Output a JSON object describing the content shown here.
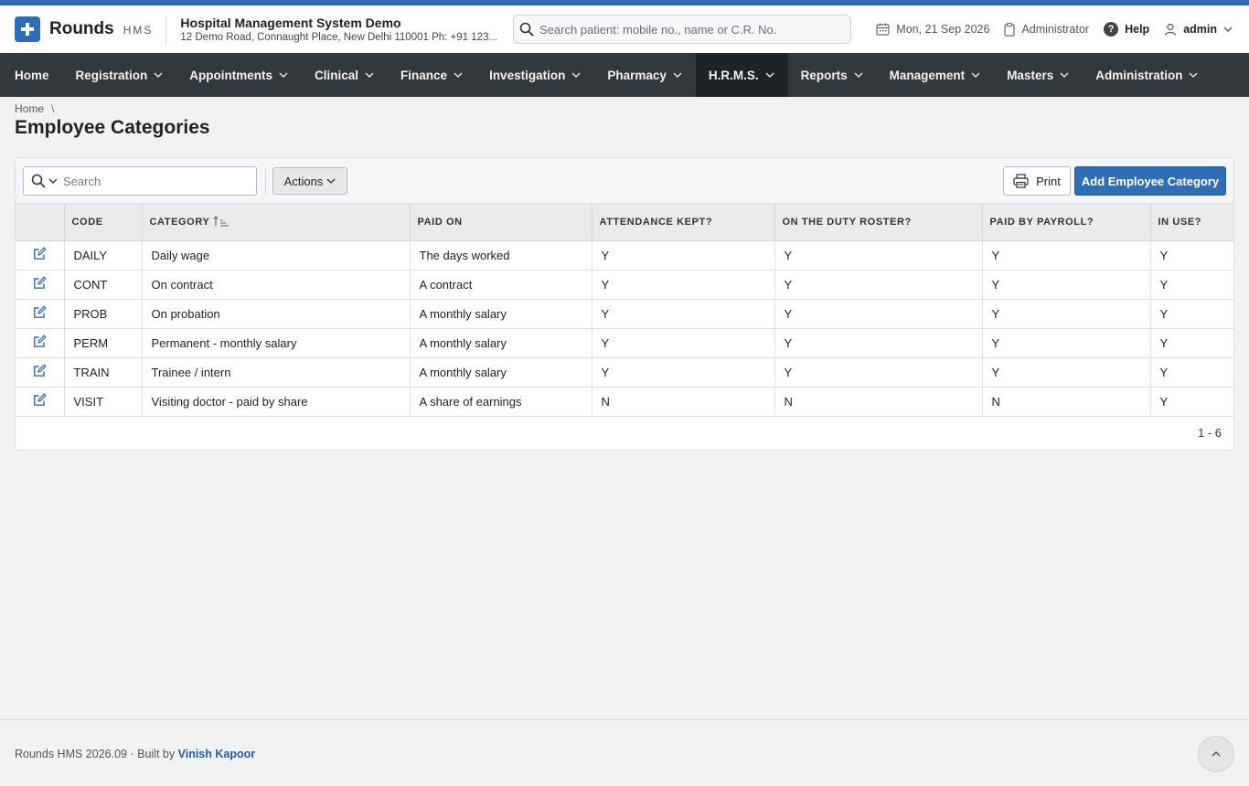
{
  "brand": {
    "name": "Rounds",
    "suffix": "HMS"
  },
  "hospital": {
    "title": "Hospital Management System Demo",
    "address": "12 Demo Road, Connaught Place, New Delhi 110001 Ph: +91 123..."
  },
  "patient_search": {
    "placeholder": "Search patient: mobile no., name or C.R. No."
  },
  "header": {
    "date": "Mon, 21 Sep 2026",
    "role": "Administrator",
    "help": "Help",
    "user": "admin"
  },
  "nav": [
    {
      "label": "Home"
    },
    {
      "label": "Registration"
    },
    {
      "label": "Appointments"
    },
    {
      "label": "Clinical"
    },
    {
      "label": "Finance"
    },
    {
      "label": "Investigation"
    },
    {
      "label": "Pharmacy"
    },
    {
      "label": "H.R.M.S."
    },
    {
      "label": "Reports"
    },
    {
      "label": "Management"
    },
    {
      "label": "Masters"
    },
    {
      "label": "Administration"
    }
  ],
  "breadcrumb": {
    "home": "Home",
    "separator": "\\"
  },
  "page": {
    "title": "Employee Categories"
  },
  "toolbar": {
    "search_placeholder": "Search",
    "actions_label": "Actions",
    "print_label": "Print",
    "add_label": "Add Employee Category"
  },
  "table": {
    "headers": [
      "CODE",
      "CATEGORY",
      "PAID ON",
      "ATTENDANCE KEPT?",
      "ON THE DUTY ROSTER?",
      "PAID BY PAYROLL?",
      "IN USE?"
    ],
    "rows": [
      [
        "DAILY",
        "Daily wage",
        "The days worked",
        "Y",
        "Y",
        "Y",
        "Y"
      ],
      [
        "CONT",
        "On contract",
        "A contract",
        "Y",
        "Y",
        "Y",
        "Y"
      ],
      [
        "PROB",
        "On probation",
        "A monthly salary",
        "Y",
        "Y",
        "Y",
        "Y"
      ],
      [
        "PERM",
        "Permanent - monthly salary",
        "A monthly salary",
        "Y",
        "Y",
        "Y",
        "Y"
      ],
      [
        "TRAIN",
        "Trainee / intern",
        "A monthly salary",
        "Y",
        "Y",
        "Y",
        "Y"
      ],
      [
        "VISIT",
        "Visiting doctor - paid by share",
        "A share of earnings",
        "N",
        "N",
        "N",
        "Y"
      ]
    ]
  },
  "pagination": {
    "range": "1 - 6"
  },
  "footer": {
    "version": "Rounds HMS 2026.09",
    "built_by": "· Built by",
    "author": "Vinish Kapoor"
  },
  "colors": {
    "accent": "#2f6db5",
    "nav_bg": "#33383d",
    "nav_active": "#1f2327"
  }
}
